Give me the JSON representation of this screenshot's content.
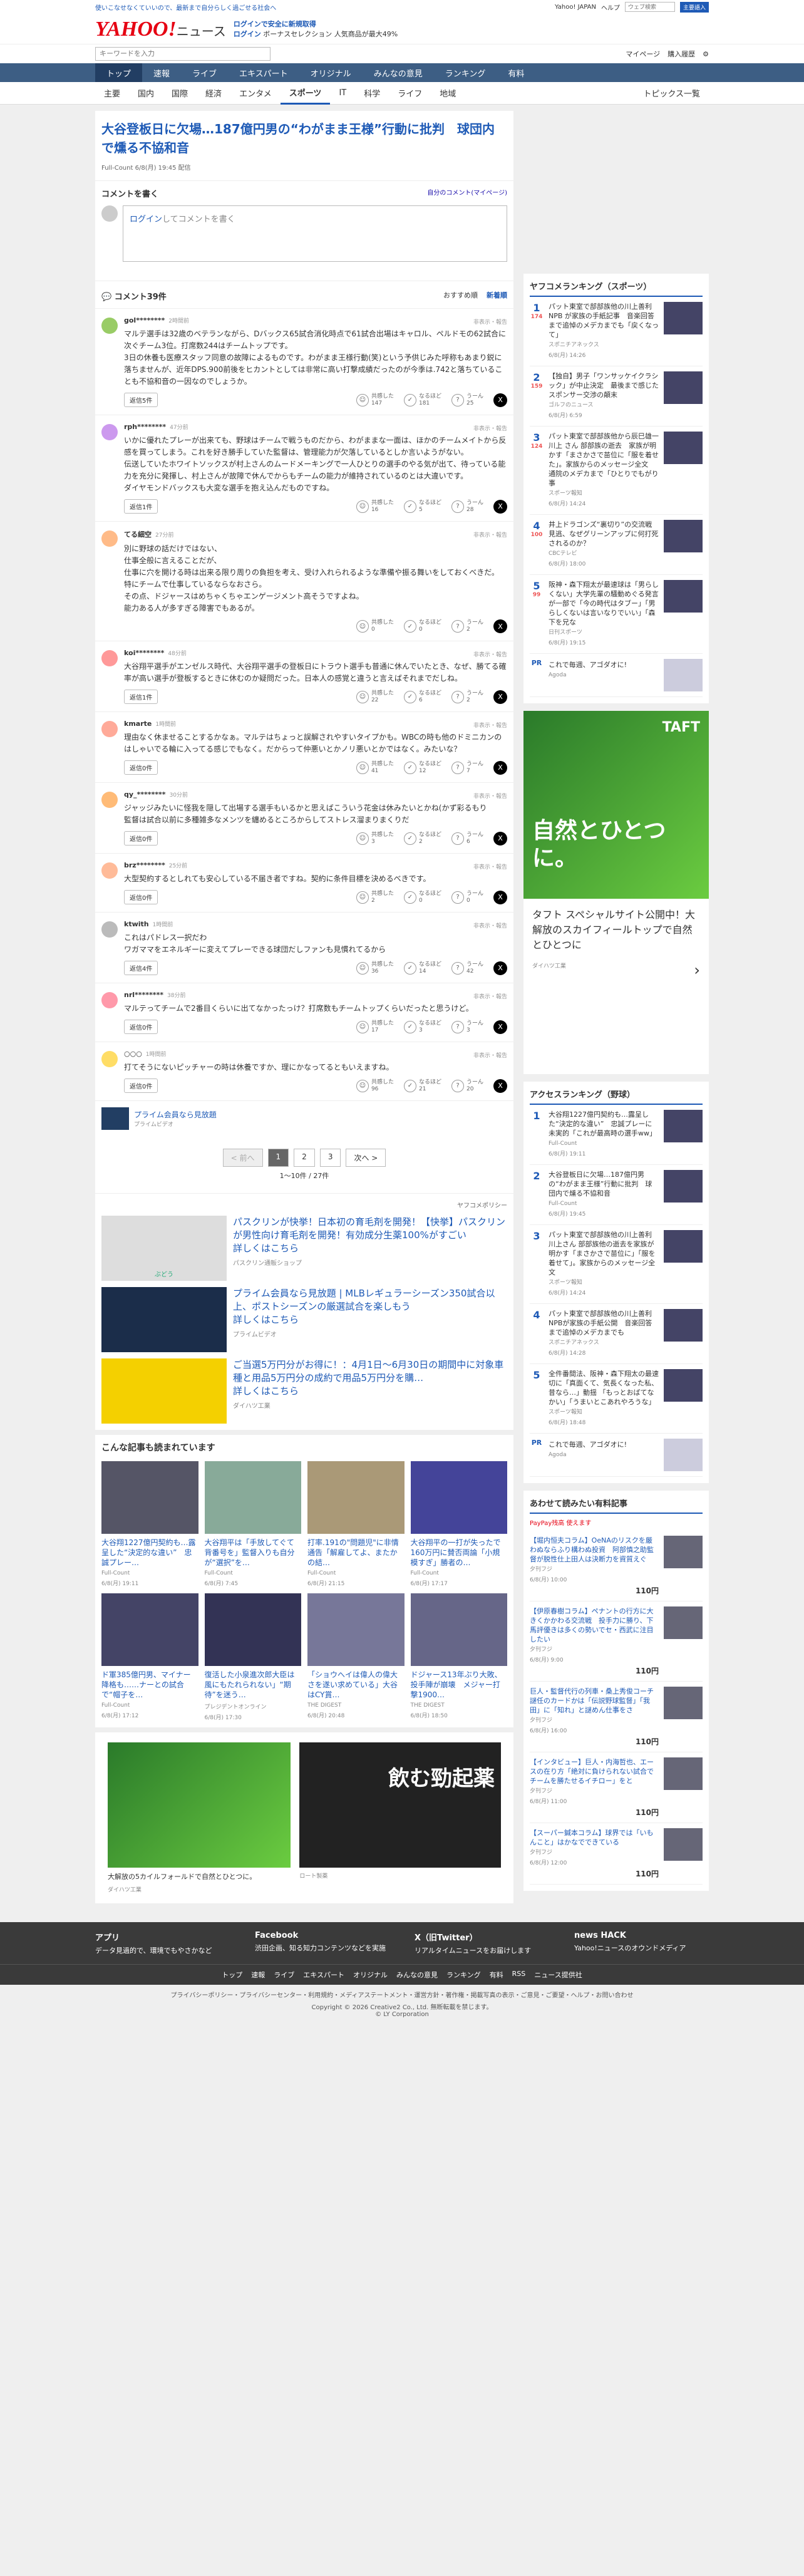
{
  "topbar": {
    "left": "使いこなせなくていいので、最新まで自分らしく過ごせる社会へ",
    "yahoo": "Yahoo! JAPAN",
    "help": "ヘルプ",
    "search_ph": "ウェブ検索",
    "search_btn": "主要語入"
  },
  "header": {
    "logo": "YAHOO!",
    "logo_sub": "ニュース",
    "promo1": "ログインで安全に新規取得",
    "promo2": "ログイン",
    "promo3": "ボーナスセレクション 人気商品が最大49%"
  },
  "subhdr": {
    "search_ph": "キーワードを入力",
    "mypage": "マイページ",
    "buy": "購入履歴"
  },
  "nav1": [
    "トップ",
    "速報",
    "ライブ",
    "エキスパート",
    "オリジナル",
    "みんなの意見",
    "ランキング",
    "有料"
  ],
  "nav2": [
    "主要",
    "国内",
    "国際",
    "経済",
    "エンタメ",
    "スポーツ",
    "IT",
    "科学",
    "ライフ",
    "地域"
  ],
  "nav2_last": "トピックス一覧",
  "article": {
    "title": "大谷登板日に欠場…187億円男の“わがまま王様”行動に批判　球団内で燻る不協和音",
    "source": "Full-Count",
    "date": "6/8(月) 19:45 配信"
  },
  "cwrite": {
    "title": "コメントを書く",
    "link": "自分のコメント(マイページ)",
    "login": "ログイン",
    "rest": "してコメントを書く"
  },
  "chead": {
    "title": "コメント39件",
    "sort1": "おすすめ順",
    "sort2": "新着順"
  },
  "comments": [
    {
      "user": "gol********",
      "time": "2時間前",
      "report": "非表示・報告",
      "text": "マルテ選手は32歳のベテランながら、Dバックス65試合消化時点で61試合出場はキャロル、ペルドモの62試合に次ぐチーム3位。打席数244はチームトップです。\n3日の休養も医療スタッフ同意の故障によるものです。わがまま王様行動(笑)という予供じみた呼称もあまり鋭に落ちませんが、近年DPS.900前後をヒカントとしては非常に高い打撃成績だったのが今季は.742と落ちていることも不協和音の一因なのでしょうか。",
      "reply": "返信5件",
      "r1": "共感した",
      "c1": "147",
      "r2": "なるほど",
      "c2": "181",
      "r3": "うーん",
      "c3": "25"
    },
    {
      "user": "rph********",
      "time": "47分前",
      "report": "非表示・報告",
      "text": "いかに優れたプレーが出来ても、野球はチームで戦うものだから、わがままな一面は、ほかのチームメイトから反感を買ってしまう。これを好き勝手していた監督は、管理能力が欠落しているとしか言いようがない。\n伝送していたホワイトソックスが村上さんのムードメーキングで一人ひとりの選手のやる気が出て、待っている能力を充分に発揮し、村上さんが故障で休んでからもチームの能力が維持されているのとは大違いです。\nダイヤモンドバックスも大変な選手を抱え込んだものですね。",
      "reply": "返信1件",
      "r1": "共感した",
      "c1": "16",
      "r2": "なるほど",
      "c2": "5",
      "r3": "うーん",
      "c3": "28"
    },
    {
      "user": "てる細空",
      "time": "27分前",
      "report": "非表示・報告",
      "text": "別に野球の話だけではない、\n仕事全般に言えることだが、\n仕事に穴を開ける時は出来る限り周りの負担を考え、受け入れられるような準備や振る舞いをしておくべきだ。\n特にチームで仕事しているならなおさら。\nその点、ドジャースはめちゃくちゃエンゲージメント高そうですよね。\n能力ある人が多すぎる障害でもあるが。",
      "reply": "",
      "r1": "共感した",
      "c1": "0",
      "r2": "なるほど",
      "c2": "0",
      "r3": "うーん",
      "c3": "2"
    },
    {
      "user": "koi********",
      "time": "48分前",
      "report": "非表示・報告",
      "text": "大谷翔平選手がエンゼルス時代、大谷翔平選手の登板日にトラウト選手も普通に休んでいたとき、なぜ、勝てる確率が高い選手が登板するときに休むのか疑問だった。日本人の感覚と違うと言えばそれまでだしね。",
      "reply": "返信1件",
      "r1": "共感した",
      "c1": "22",
      "r2": "なるほど",
      "c2": "6",
      "r3": "うーん",
      "c3": "2"
    },
    {
      "user": "kmarte",
      "time": "1時間前",
      "report": "非表示・報告",
      "text": "理由なく休ませることするかなぁ。マルテはちょっと誤解されやすいタイプかも。WBCの時も他のドミニカンのはしゃいでる輪に入ってる感じでもなく。だからって仲悪いとかノリ悪いとかではなく。みたいな？",
      "reply": "返信0件",
      "r1": "共感した",
      "c1": "41",
      "r2": "なるほど",
      "c2": "12",
      "r3": "うーん",
      "c3": "7"
    },
    {
      "user": "qy_********",
      "time": "30分前",
      "report": "非表示・報告",
      "text": "ジャッジみたいに怪我を隠して出場する選手もいるかと思えばこういう花金は休みたいとかね(かず彩るもり\n監督は試合以前に多種雑多なメンツを纏めるところからしてストレス溜まりまくりだ",
      "reply": "返信0件",
      "r1": "共感した",
      "c1": "3",
      "r2": "なるほど",
      "c2": "2",
      "r3": "うーん",
      "c3": "6"
    },
    {
      "user": "brz********",
      "time": "25分前",
      "report": "非表示・報告",
      "text": "大型契約するとしれても安心している不届き者ですね。契約に条件目標を決めるべきです。",
      "reply": "返信0件",
      "r1": "共感した",
      "c1": "2",
      "r2": "なるほど",
      "c2": "0",
      "r3": "うーん",
      "c3": "0"
    },
    {
      "user": "ktwith",
      "time": "1時間前",
      "report": "非表示・報告",
      "text": "これはパドレス一択だわ\nワガママをエネルギーに変えてプレーできる球団だしファンも見慣れてるから",
      "reply": "返信4件",
      "r1": "共感した",
      "c1": "36",
      "r2": "なるほど",
      "c2": "14",
      "r3": "うーん",
      "c3": "42"
    },
    {
      "user": "nrl********",
      "time": "38分前",
      "report": "非表示・報告",
      "text": "マルテってチームで2番目くらいに出てなかったっけ？打席数もチームトップくらいだったと思うけど。",
      "reply": "返信0件",
      "r1": "共感した",
      "c1": "17",
      "r2": "なるほど",
      "c2": "3",
      "r3": "うーん",
      "c3": "3"
    },
    {
      "user": "○○○",
      "time": "1時間前",
      "report": "非表示・報告",
      "text": "打てそうにないピッチャーの時は休養ですか、理にかなってるともいえますね。",
      "reply": "返信0件",
      "r1": "共感した",
      "c1": "96",
      "r2": "なるほど",
      "c2": "21",
      "r3": "うーん",
      "c3": "20"
    }
  ],
  "premium": {
    "title": "プライム会員なら見放題",
    "sub": "プライムビデオ"
  },
  "pager": {
    "prev": "< 前へ",
    "p1": "1",
    "p2": "2",
    "p3": "3",
    "next": "次へ >",
    "count": "1〜10件 / 27件"
  },
  "ads": {
    "policy": "ヤフコメポリシー",
    "items": [
      {
        "title": "パスクリンが快挙！日本初の育毛剤を開発！【快挙】パスクリンが男性向け育毛剤を開発！有効成分生薬100%がすごい\n詳しくはこちら",
        "sub": "パスクリン通販ショップ"
      },
      {
        "title": "プライム会員なら見放題 | MLBレギュラーシーズン350試合以上、ポストシーズンの厳選試合を楽しもう\n詳しくはこちら",
        "sub": "プライムビデオ"
      },
      {
        "title": "ご当選5万円分がお得に！：4月1日〜6月30日の期間中に対象車種と用品5万円分の成約で用品5万円分を購…\n詳しくはこちら",
        "sub": "ダイハツ工業"
      }
    ],
    "logo_sub": "ぶどう"
  },
  "related": {
    "title": "こんな記事も読まれています",
    "items": [
      {
        "t": "大谷翔1227億円契約も…露呈した“決定的な違い”　忠誠プレー…",
        "s": "Full-Count",
        "d": "6/8(月) 19:11"
      },
      {
        "t": "大谷翔平は「手放してぐて背番号を」監督入りも自分が“選択”を…",
        "s": "Full-Count",
        "d": "6/8(月) 7:45"
      },
      {
        "t": "打率.191の\"問題児\"に非情通告「解雇してよ、またかの結…",
        "s": "Full-Count",
        "d": "6/8(月) 21:15"
      },
      {
        "t": "大谷翔平の一打が失ったで160万円に賛否両論「小規模すぎ」勝者の…",
        "s": "Full-Count",
        "d": "6/8(月) 17:17"
      },
      {
        "t": "ド軍385億円男、マイナー降格も……ナーとの試合で“帽子を…",
        "s": "Full-Count",
        "d": "6/8(月) 17:12"
      },
      {
        "t": "復活した小泉進次郎大臣は風にもたれられない」“期待”を迷う…",
        "s": "プレジデントオンライン",
        "d": "6/8(月) 17:30"
      },
      {
        "t": "「ショウへイは偉人の偉大さを遂い求めている」大谷はCY賞…",
        "s": "THE DIGEST",
        "d": "6/8(月) 20:48"
      },
      {
        "t": "ドジャース13年ぶり大敗、投手陣が崩壊　メジャー打撃1900…",
        "s": "THE DIGEST",
        "d": "6/8(月) 18:50"
      }
    ]
  },
  "bottomads": {
    "a1": "大解放の5カイルフォールドで自然とひとつに。",
    "a1s": "ダイハツ工業",
    "a2": "飲む勁起薬",
    "a2s": "ロート製薬"
  },
  "rank1": {
    "title": "ヤフコメランキング（スポーツ）",
    "items": [
      {
        "n": "1",
        "c": "174",
        "t": "パット東室で部部族他の川上善利　NPB が家族の手紙記事　音楽回答まで追悼のメデカまでも「戻くなって」",
        "s": "スポニチアネックス",
        "d": "6/8(月) 14:26"
      },
      {
        "n": "2",
        "c": "159",
        "t": "【独自】男子「ワンサッケイクラシック」が中止決定　最後まで感じたスポンサー交渉の顛末",
        "s": "ゴルフのニュース",
        "d": "6/8(月) 6:59"
      },
      {
        "n": "3",
        "c": "124",
        "t": "パット東室で部部族他から辰巳雄一 川上 さん 部部族の逝去　家族が明かす「まさかさで苗位に「服を着せた」。家族からのメッセージ全文　通院のメデカまで「ひとりでもがり事",
        "s": "スポーツ報知",
        "d": "6/8(月) 14:24"
      },
      {
        "n": "4",
        "c": "100",
        "t": "井上ドラゴンズ“裏切り”の交流戦見逃、なぜグリーンアップに何打死されるのか？",
        "s": "CBCテレビ",
        "d": "6/8(月) 18:00"
      },
      {
        "n": "5",
        "c": "99",
        "t": "阪神・森下翔太が最速球は「男らしくない」大学先輩の騒動めぐる発言が一部で「今の時代はタブー」「男らしくないは言いなりでいい」「森下を兄な",
        "s": "日刊スポーツ",
        "d": "6/8(月) 19:15"
      }
    ],
    "pr": "これで毎週、アゴダオに!",
    "prs": "Agoda"
  },
  "sad": {
    "t1": "TAFT",
    "t2": "自然とひとつに。",
    "t3": "タフト スペシャルサイト公開中！大解放のスカイフィールトップで自然とひとつに",
    "t4": "ダイハツ工業"
  },
  "rank2": {
    "title": "アクセスランキング（野球）",
    "items": [
      {
        "n": "1",
        "t": "大谷翔1227億円契約も…露呈した“決定的な違い”　忠誠プレーに未実的「これが最高時の選手ww」",
        "s": "Full-Count",
        "d": "6/8(月) 19:11"
      },
      {
        "n": "2",
        "t": "大谷登板日に欠場…187億円男の“わがまま王様”行動に批判　球団内で燻る不協和音",
        "s": "Full-Count",
        "d": "6/8(月) 19:45"
      },
      {
        "n": "3",
        "t": "パット東室で部部族他の川上善利 川上さん 部部族他の逝去を家族が明かす「まさかさで苗位に」「服を着せて」。家族からのメッセージ全文",
        "s": "スポーツ報知",
        "d": "6/8(月) 14:24"
      },
      {
        "n": "4",
        "t": "パット東室で部部族他の川上善利 NPBが家族の手紙公開　音楽回答まで追悼のメデカまでも",
        "s": "スポニチアネックス",
        "d": "6/8(月) 14:28"
      },
      {
        "n": "5",
        "t": "全件番間法、阪神・森下翔太の最速切に「真面くて、気長くなった私、昔なら…」動揺 「もっとおばてなかい」「うまいとこあれやろうな」",
        "s": "スポーツ報知",
        "d": "6/8(月) 18:48"
      }
    ],
    "pr": "これで毎週、アゴダオに!",
    "prs": "Agoda"
  },
  "paid": {
    "title": "あわせて読みたい有料記事",
    "logo": "PayPay残高 使えます",
    "items": [
      {
        "t": "【堀内恒夫コラム】OeNAのリスクを厳わぬならふり構わぬ投資　阿部慎之助監督が脱性仕上田人は決断力を資質えぐ",
        "s": "夕刊フジ",
        "d": "6/8(月) 10:00",
        "p": "110円"
      },
      {
        "t": "【伊原春樹コラム】ペナントの行方に大きくかかわる交流戦　投手力に勝り、下馬評優きは多くの勢いでセ・西武に注目したい",
        "s": "夕刊フジ",
        "d": "6/8(月) 9:00",
        "p": "110円"
      },
      {
        "t": "巨人・監督代行の列車・桑上秀俊コーチ謎任のカードかは「伝説野球監督」「我田」に「知れ」と謎めん仕事をさ",
        "s": "夕刊フジ",
        "d": "6/8(月) 16:00",
        "p": "110円"
      },
      {
        "t": "【インタビュー】巨人・内海哲也、エースの在り方「絶対に負けられない試合でチームを勝たせるイチロー」をと",
        "s": "夕刊フジ",
        "d": "6/8(月) 11:00",
        "p": "110円"
      },
      {
        "t": "【スーパー鍼本コラム】球界では「いもんこと」はかなでできている",
        "s": "夕刊フジ",
        "d": "6/8(月) 12:00",
        "p": "110円"
      }
    ]
  },
  "footer": {
    "app": "アプリ",
    "app_s": "データ見過的で、環境でもやさかなど",
    "fb": "Facebook",
    "fb_s": "渋田企画、知る知力コンテンツなどを実施",
    "x": "X（旧Twitter）",
    "x_s": "リアルタイムニュースをお届けします",
    "hack": "news HACK",
    "hack_s": "Yahoo!ニュースのオウンドメディア"
  },
  "fnav": [
    "トップ",
    "速報",
    "ライブ",
    "エキスパート",
    "オリジナル",
    "みんなの意見",
    "ランキング",
    "有料",
    "RSS",
    "ニュース提供社"
  ],
  "flinks": "プライバシーポリシー・プライバシーセンター・利用規約・メディアステートメント・運営方針・著作権・掲載写真の表示・ご意見・ご要望・ヘルプ・お問い合わせ",
  "copy": "Copyright © 2026 Creative2 Co., Ltd. 無断転載を禁じます。",
  "copy2": "© LY Corporation",
  "colors": {
    "brand": "#1e5ab6",
    "nav": "#3d5e84",
    "red": "#e60012"
  }
}
